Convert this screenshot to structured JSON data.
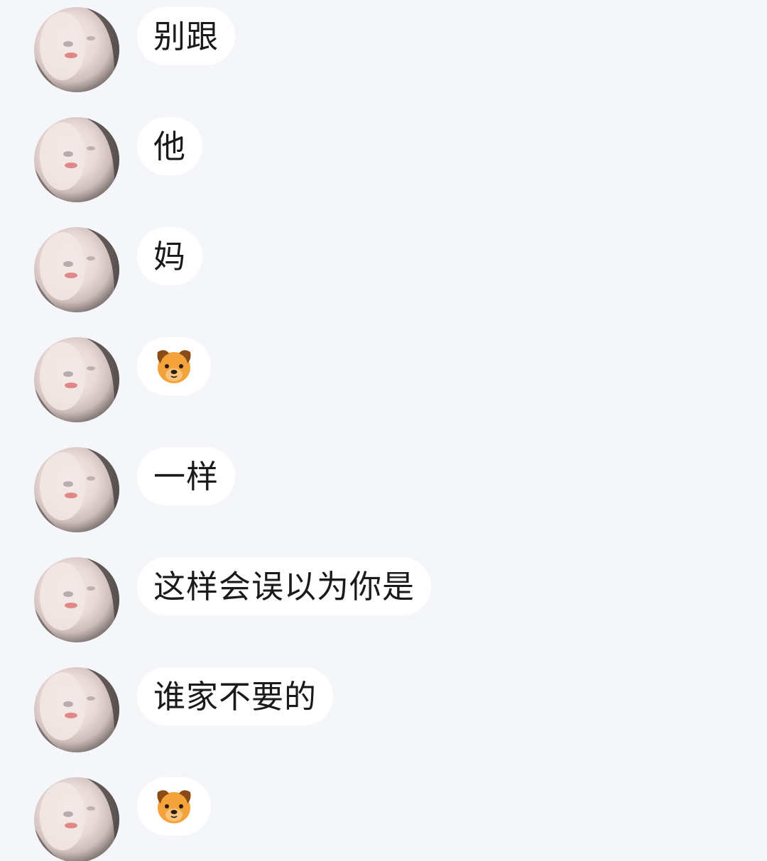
{
  "conversation": {
    "messages": [
      {
        "kind": "text",
        "text": "别跟"
      },
      {
        "kind": "text",
        "text": "他"
      },
      {
        "kind": "text",
        "text": "妈"
      },
      {
        "kind": "emoji",
        "icon": "dog-face-icon"
      },
      {
        "kind": "text",
        "text": "一样"
      },
      {
        "kind": "text",
        "text": "这样会误以为你是"
      },
      {
        "kind": "text",
        "text": "谁家不要的"
      },
      {
        "kind": "emoji",
        "icon": "dog-face-icon"
      }
    ]
  },
  "colors": {
    "background": "#f4f6f9",
    "bubble": "#ffffff",
    "text": "#1a1a1a",
    "emoji_orange": "#f4a33a",
    "emoji_dark": "#8a4b14"
  }
}
